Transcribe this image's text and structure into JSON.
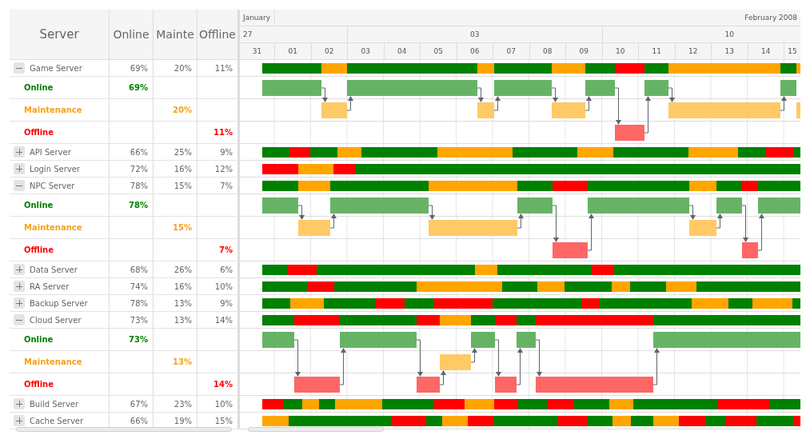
{
  "table": {
    "columns": [
      "Server",
      "Online",
      "Mainte",
      "Offline"
    ]
  },
  "timeline_header": {
    "months": [
      "January",
      "February 2008"
    ],
    "weeks": [
      {
        "label": "27",
        "days": [
          "31",
          "01",
          "02"
        ]
      },
      {
        "label": "03",
        "days": [
          "03",
          "04",
          "05",
          "06",
          "07",
          "08",
          "09"
        ]
      },
      {
        "label": "10",
        "days": [
          "10",
          "11",
          "12",
          "13",
          "14",
          "15"
        ]
      }
    ]
  },
  "servers": [
    {
      "name": "Game Server",
      "online": "69%",
      "maintenance": "20%",
      "offline": "11%",
      "expanded": true,
      "segments": [
        {
          "kind": "online"
        },
        {
          "kind": "maintenance"
        },
        {
          "kind": "online"
        },
        {
          "kind": "maintenance"
        },
        {
          "kind": "online"
        },
        {
          "kind": "maintenance"
        },
        {
          "kind": "online"
        },
        {
          "kind": "offline"
        },
        {
          "kind": "online"
        },
        {
          "kind": "maintenance"
        },
        {
          "kind": "online"
        },
        {
          "kind": "maintenance"
        }
      ],
      "children": [
        {
          "kind": "online",
          "label": "Online",
          "value": "69%"
        },
        {
          "kind": "maintenance",
          "label": "Maintenance",
          "value": "20%"
        },
        {
          "kind": "offline",
          "label": "Offline",
          "value": "11%"
        }
      ]
    },
    {
      "name": "API Server",
      "online": "66%",
      "maintenance": "25%",
      "offline": "9%",
      "expanded": false,
      "segments": [
        {
          "kind": "online"
        },
        {
          "kind": "offline"
        },
        {
          "kind": "online"
        },
        {
          "kind": "maintenance"
        },
        {
          "kind": "online"
        },
        {
          "kind": "maintenance"
        },
        {
          "kind": "online"
        },
        {
          "kind": "maintenance"
        },
        {
          "kind": "online"
        },
        {
          "kind": "maintenance"
        },
        {
          "kind": "online"
        },
        {
          "kind": "offline"
        },
        {
          "kind": "online"
        }
      ]
    },
    {
      "name": "Login Server",
      "online": "72%",
      "maintenance": "16%",
      "offline": "12%",
      "expanded": false,
      "segments": [
        {
          "kind": "offline"
        },
        {
          "kind": "maintenance"
        },
        {
          "kind": "offline"
        },
        {
          "kind": "online"
        }
      ]
    },
    {
      "name": "NPC Server",
      "online": "78%",
      "maintenance": "15%",
      "offline": "7%",
      "expanded": true,
      "segments": [
        {
          "kind": "online"
        },
        {
          "kind": "maintenance"
        },
        {
          "kind": "online"
        },
        {
          "kind": "maintenance"
        },
        {
          "kind": "online"
        },
        {
          "kind": "offline"
        },
        {
          "kind": "online"
        },
        {
          "kind": "maintenance"
        },
        {
          "kind": "online"
        },
        {
          "kind": "offline"
        },
        {
          "kind": "online"
        }
      ],
      "children": [
        {
          "kind": "online",
          "label": "Online",
          "value": "78%"
        },
        {
          "kind": "maintenance",
          "label": "Maintenance",
          "value": "15%"
        },
        {
          "kind": "offline",
          "label": "Offline",
          "value": "7%"
        }
      ]
    },
    {
      "name": "Data Server",
      "online": "68%",
      "maintenance": "26%",
      "offline": "6%",
      "expanded": false,
      "segments": [
        {
          "kind": "online"
        },
        {
          "kind": "offline"
        },
        {
          "kind": "online"
        },
        {
          "kind": "maintenance"
        },
        {
          "kind": "online"
        },
        {
          "kind": "offline"
        },
        {
          "kind": "online"
        }
      ]
    },
    {
      "name": "RA Server",
      "online": "74%",
      "maintenance": "16%",
      "offline": "10%",
      "expanded": false,
      "segments": [
        {
          "kind": "online"
        },
        {
          "kind": "offline"
        },
        {
          "kind": "online"
        },
        {
          "kind": "maintenance"
        },
        {
          "kind": "online"
        },
        {
          "kind": "maintenance"
        },
        {
          "kind": "online"
        },
        {
          "kind": "maintenance"
        },
        {
          "kind": "online"
        },
        {
          "kind": "maintenance"
        },
        {
          "kind": "online"
        }
      ]
    },
    {
      "name": "Backup Server",
      "online": "78%",
      "maintenance": "13%",
      "offline": "9%",
      "expanded": false,
      "segments": [
        {
          "kind": "online"
        },
        {
          "kind": "maintenance"
        },
        {
          "kind": "online"
        },
        {
          "kind": "offline"
        },
        {
          "kind": "online"
        },
        {
          "kind": "offline"
        },
        {
          "kind": "online"
        },
        {
          "kind": "offline"
        },
        {
          "kind": "online"
        },
        {
          "kind": "maintenance"
        },
        {
          "kind": "online"
        },
        {
          "kind": "maintenance"
        },
        {
          "kind": "online"
        }
      ]
    },
    {
      "name": "Cloud Server",
      "online": "73%",
      "maintenance": "13%",
      "offline": "14%",
      "expanded": true,
      "segments": [
        {
          "kind": "online"
        },
        {
          "kind": "offline"
        },
        {
          "kind": "online"
        },
        {
          "kind": "offline"
        },
        {
          "kind": "maintenance"
        },
        {
          "kind": "online"
        },
        {
          "kind": "offline"
        },
        {
          "kind": "online"
        },
        {
          "kind": "offline"
        },
        {
          "kind": "online"
        }
      ],
      "children": [
        {
          "kind": "online",
          "label": "Online",
          "value": "73%"
        },
        {
          "kind": "maintenance",
          "label": "Maintenance",
          "value": "13%"
        },
        {
          "kind": "offline",
          "label": "Offline",
          "value": "14%"
        }
      ]
    },
    {
      "name": "Build Server",
      "online": "67%",
      "maintenance": "23%",
      "offline": "10%",
      "expanded": false,
      "segments": [
        {
          "kind": "offline"
        },
        {
          "kind": "online"
        },
        {
          "kind": "maintenance"
        },
        {
          "kind": "online"
        },
        {
          "kind": "maintenance"
        },
        {
          "kind": "online"
        },
        {
          "kind": "offline"
        },
        {
          "kind": "maintenance"
        },
        {
          "kind": "offline"
        },
        {
          "kind": "online"
        },
        {
          "kind": "offline"
        },
        {
          "kind": "online"
        },
        {
          "kind": "maintenance"
        },
        {
          "kind": "online"
        },
        {
          "kind": "offline"
        },
        {
          "kind": "online"
        }
      ]
    },
    {
      "name": "Cache Server",
      "online": "66%",
      "maintenance": "19%",
      "offline": "15%",
      "expanded": false,
      "segments": [
        {
          "kind": "maintenance"
        },
        {
          "kind": "online"
        },
        {
          "kind": "offline"
        },
        {
          "kind": "online"
        },
        {
          "kind": "maintenance"
        },
        {
          "kind": "offline"
        },
        {
          "kind": "online"
        },
        {
          "kind": "offline"
        },
        {
          "kind": "online"
        },
        {
          "kind": "maintenance"
        },
        {
          "kind": "online"
        },
        {
          "kind": "maintenance"
        },
        {
          "kind": "offline"
        },
        {
          "kind": "online"
        },
        {
          "kind": "offline"
        },
        {
          "kind": "online"
        },
        {
          "kind": "offline"
        }
      ]
    }
  ]
}
